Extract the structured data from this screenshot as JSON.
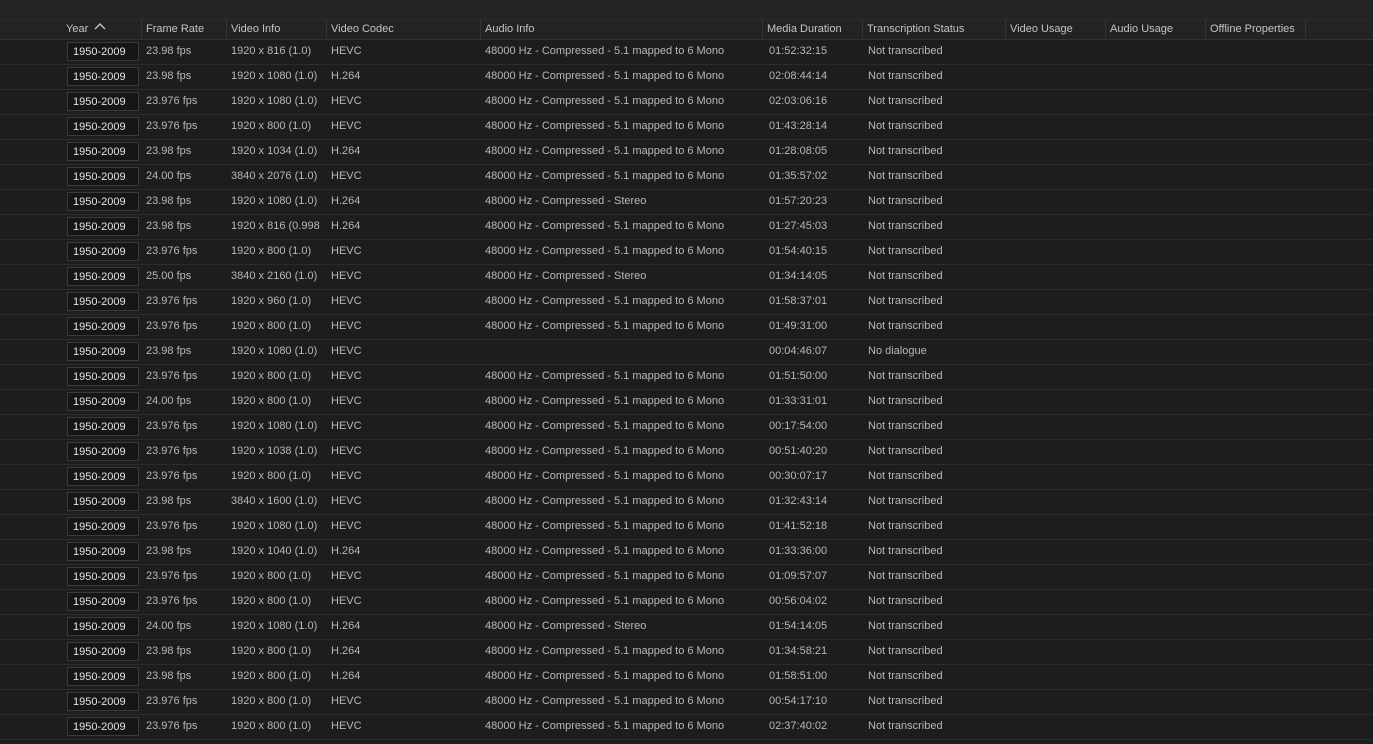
{
  "columns": [
    {
      "label": "Year"
    },
    {
      "label": "Frame Rate"
    },
    {
      "label": "Video Info"
    },
    {
      "label": "Video Codec"
    },
    {
      "label": "Audio Info"
    },
    {
      "label": "Media Duration"
    },
    {
      "label": "Transcription Status"
    },
    {
      "label": "Video Usage"
    },
    {
      "label": "Audio Usage"
    },
    {
      "label": "Offline Properties"
    }
  ],
  "sort": {
    "column": "Year",
    "direction": "ascending",
    "icon": "chevron-up-icon"
  },
  "rows": [
    {
      "year": "1950-2009",
      "frame_rate": "23.98 fps",
      "video_info": "1920 x 816 (1.0)",
      "codec": "HEVC",
      "audio": "48000 Hz - Compressed - 5.1 mapped to 6 Mono",
      "duration": "01:52:32:15",
      "transcription": "Not transcribed"
    },
    {
      "year": "1950-2009",
      "frame_rate": "23.98 fps",
      "video_info": "1920 x 1080 (1.0)",
      "codec": "H.264",
      "audio": "48000 Hz - Compressed - 5.1 mapped to 6 Mono",
      "duration": "02:08:44:14",
      "transcription": "Not transcribed"
    },
    {
      "year": "1950-2009",
      "frame_rate": "23.976 fps",
      "video_info": "1920 x 1080 (1.0)",
      "codec": "HEVC",
      "audio": "48000 Hz - Compressed - 5.1 mapped to 6 Mono",
      "duration": "02:03:06:16",
      "transcription": "Not transcribed"
    },
    {
      "year": "1950-2009",
      "frame_rate": "23.976 fps",
      "video_info": "1920 x 800 (1.0)",
      "codec": "HEVC",
      "audio": "48000 Hz - Compressed - 5.1 mapped to 6 Mono",
      "duration": "01:43:28:14",
      "transcription": "Not transcribed"
    },
    {
      "year": "1950-2009",
      "frame_rate": "23.98 fps",
      "video_info": "1920 x 1034 (1.0)",
      "codec": "H.264",
      "audio": "48000 Hz - Compressed - 5.1 mapped to 6 Mono",
      "duration": "01:28:08:05",
      "transcription": "Not transcribed"
    },
    {
      "year": "1950-2009",
      "frame_rate": "24.00 fps",
      "video_info": "3840 x 2076 (1.0)",
      "codec": "HEVC",
      "audio": "48000 Hz - Compressed - 5.1 mapped to 6 Mono",
      "duration": "01:35:57:02",
      "transcription": "Not transcribed"
    },
    {
      "year": "1950-2009",
      "frame_rate": "23.98 fps",
      "video_info": "1920 x 1080 (1.0)",
      "codec": "H.264",
      "audio": "48000 Hz - Compressed - Stereo",
      "duration": "01:57:20:23",
      "transcription": "Not transcribed"
    },
    {
      "year": "1950-2009",
      "frame_rate": "23.98 fps",
      "video_info": "1920 x 816 (0.998",
      "codec": "H.264",
      "audio": "48000 Hz - Compressed - 5.1 mapped to 6 Mono",
      "duration": "01:27:45:03",
      "transcription": "Not transcribed"
    },
    {
      "year": "1950-2009",
      "frame_rate": "23.976 fps",
      "video_info": "1920 x 800 (1.0)",
      "codec": "HEVC",
      "audio": "48000 Hz - Compressed - 5.1 mapped to 6 Mono",
      "duration": "01:54:40:15",
      "transcription": "Not transcribed"
    },
    {
      "year": "1950-2009",
      "frame_rate": "25.00 fps",
      "video_info": "3840 x 2160 (1.0)",
      "codec": "HEVC",
      "audio": "48000 Hz - Compressed - Stereo",
      "duration": "01:34:14:05",
      "transcription": "Not transcribed"
    },
    {
      "year": "1950-2009",
      "frame_rate": "23.976 fps",
      "video_info": "1920 x 960 (1.0)",
      "codec": "HEVC",
      "audio": "48000 Hz - Compressed - 5.1 mapped to 6 Mono",
      "duration": "01:58:37:01",
      "transcription": "Not transcribed"
    },
    {
      "year": "1950-2009",
      "frame_rate": "23.976 fps",
      "video_info": "1920 x 800 (1.0)",
      "codec": "HEVC",
      "audio": "48000 Hz - Compressed - 5.1 mapped to 6 Mono",
      "duration": "01:49:31:00",
      "transcription": "Not transcribed"
    },
    {
      "year": "1950-2009",
      "frame_rate": "23.98 fps",
      "video_info": "1920 x 1080 (1.0)",
      "codec": "HEVC",
      "audio": "",
      "duration": "00:04:46:07",
      "transcription": "No dialogue"
    },
    {
      "year": "1950-2009",
      "frame_rate": "23.976 fps",
      "video_info": "1920 x 800 (1.0)",
      "codec": "HEVC",
      "audio": "48000 Hz - Compressed - 5.1 mapped to 6 Mono",
      "duration": "01:51:50:00",
      "transcription": "Not transcribed"
    },
    {
      "year": "1950-2009",
      "frame_rate": "24.00 fps",
      "video_info": "1920 x 800 (1.0)",
      "codec": "HEVC",
      "audio": "48000 Hz - Compressed - 5.1 mapped to 6 Mono",
      "duration": "01:33:31:01",
      "transcription": "Not transcribed"
    },
    {
      "year": "1950-2009",
      "frame_rate": "23.976 fps",
      "video_info": "1920 x 1080 (1.0)",
      "codec": "HEVC",
      "audio": "48000 Hz - Compressed - 5.1 mapped to 6 Mono",
      "duration": "00:17:54:00",
      "transcription": "Not transcribed"
    },
    {
      "year": "1950-2009",
      "frame_rate": "23.976 fps",
      "video_info": "1920 x 1038 (1.0)",
      "codec": "HEVC",
      "audio": "48000 Hz - Compressed - 5.1 mapped to 6 Mono",
      "duration": "00:51:40:20",
      "transcription": "Not transcribed"
    },
    {
      "year": "1950-2009",
      "frame_rate": "23.976 fps",
      "video_info": "1920 x 800 (1.0)",
      "codec": "HEVC",
      "audio": "48000 Hz - Compressed - 5.1 mapped to 6 Mono",
      "duration": "00:30:07:17",
      "transcription": "Not transcribed"
    },
    {
      "year": "1950-2009",
      "frame_rate": "23.98 fps",
      "video_info": "3840 x 1600 (1.0)",
      "codec": "HEVC",
      "audio": "48000 Hz - Compressed - 5.1 mapped to 6 Mono",
      "duration": "01:32:43:14",
      "transcription": "Not transcribed"
    },
    {
      "year": "1950-2009",
      "frame_rate": "23.976 fps",
      "video_info": "1920 x 1080 (1.0)",
      "codec": "HEVC",
      "audio": "48000 Hz - Compressed - 5.1 mapped to 6 Mono",
      "duration": "01:41:52:18",
      "transcription": "Not transcribed"
    },
    {
      "year": "1950-2009",
      "frame_rate": "23.98 fps",
      "video_info": "1920 x 1040 (1.0)",
      "codec": "H.264",
      "audio": "48000 Hz - Compressed - 5.1 mapped to 6 Mono",
      "duration": "01:33:36:00",
      "transcription": "Not transcribed"
    },
    {
      "year": "1950-2009",
      "frame_rate": "23.976 fps",
      "video_info": "1920 x 800 (1.0)",
      "codec": "HEVC",
      "audio": "48000 Hz - Compressed - 5.1 mapped to 6 Mono",
      "duration": "01:09:57:07",
      "transcription": "Not transcribed"
    },
    {
      "year": "1950-2009",
      "frame_rate": "23.976 fps",
      "video_info": "1920 x 800 (1.0)",
      "codec": "HEVC",
      "audio": "48000 Hz - Compressed - 5.1 mapped to 6 Mono",
      "duration": "00:56:04:02",
      "transcription": "Not transcribed"
    },
    {
      "year": "1950-2009",
      "frame_rate": "24.00 fps",
      "video_info": "1920 x 1080 (1.0)",
      "codec": "H.264",
      "audio": "48000 Hz - Compressed - Stereo",
      "duration": "01:54:14:05",
      "transcription": "Not transcribed"
    },
    {
      "year": "1950-2009",
      "frame_rate": "23.98 fps",
      "video_info": "1920 x 800 (1.0)",
      "codec": "H.264",
      "audio": "48000 Hz - Compressed - 5.1 mapped to 6 Mono",
      "duration": "01:34:58:21",
      "transcription": "Not transcribed"
    },
    {
      "year": "1950-2009",
      "frame_rate": "23.98 fps",
      "video_info": "1920 x 800 (1.0)",
      "codec": "H.264",
      "audio": "48000 Hz - Compressed - 5.1 mapped to 6 Mono",
      "duration": "01:58:51:00",
      "transcription": "Not transcribed"
    },
    {
      "year": "1950-2009",
      "frame_rate": "23.976 fps",
      "video_info": "1920 x 800 (1.0)",
      "codec": "HEVC",
      "audio": "48000 Hz - Compressed - 5.1 mapped to 6 Mono",
      "duration": "00:54:17:10",
      "transcription": "Not transcribed"
    },
    {
      "year": "1950-2009",
      "frame_rate": "23.976 fps",
      "video_info": "1920 x 800 (1.0)",
      "codec": "HEVC",
      "audio": "48000 Hz - Compressed - 5.1 mapped to 6 Mono",
      "duration": "02:37:40:02",
      "transcription": "Not transcribed"
    }
  ]
}
